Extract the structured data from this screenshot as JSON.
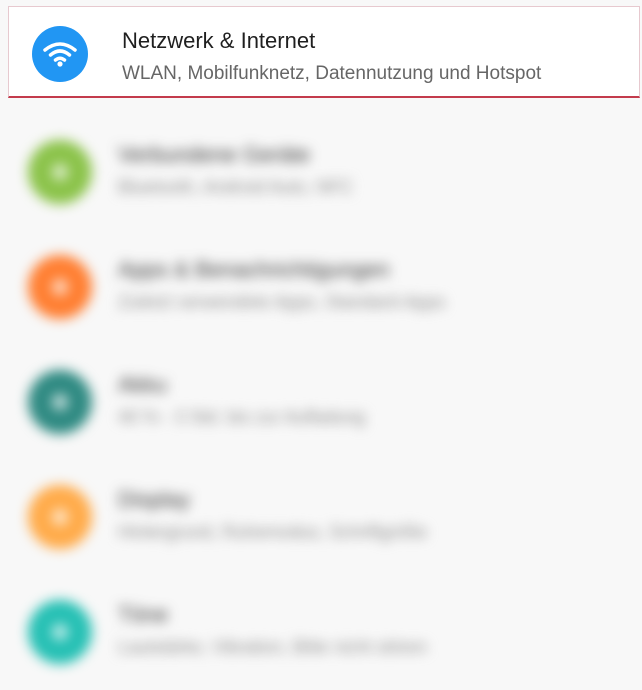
{
  "highlighted": {
    "title": "Netzwerk & Internet",
    "subtitle": "WLAN, Mobilfunknetz, Datennutzung und Hotspot",
    "icon": "wifi-icon",
    "icon_color": "#2196f3"
  },
  "blurred_items": [
    {
      "title": "Verbundene Geräte",
      "subtitle": "Bluetooth, Android Auto, NFC",
      "color": "#8bc34a"
    },
    {
      "title": "Apps & Benachrichtigungen",
      "subtitle": "Zuletzt verwendete Apps, Standard-Apps",
      "color": "#ff7f32"
    },
    {
      "title": "Akku",
      "subtitle": "40 % - 3 Std. bis zur Aufladung",
      "color": "#2f8a82"
    },
    {
      "title": "Display",
      "subtitle": "Hintergrund, Ruhemodus, Schriftgröße",
      "color": "#ffab4a"
    },
    {
      "title": "Töne",
      "subtitle": "Lautstärke, Vibration, Bitte nicht stören",
      "color": "#26c0b4"
    }
  ]
}
